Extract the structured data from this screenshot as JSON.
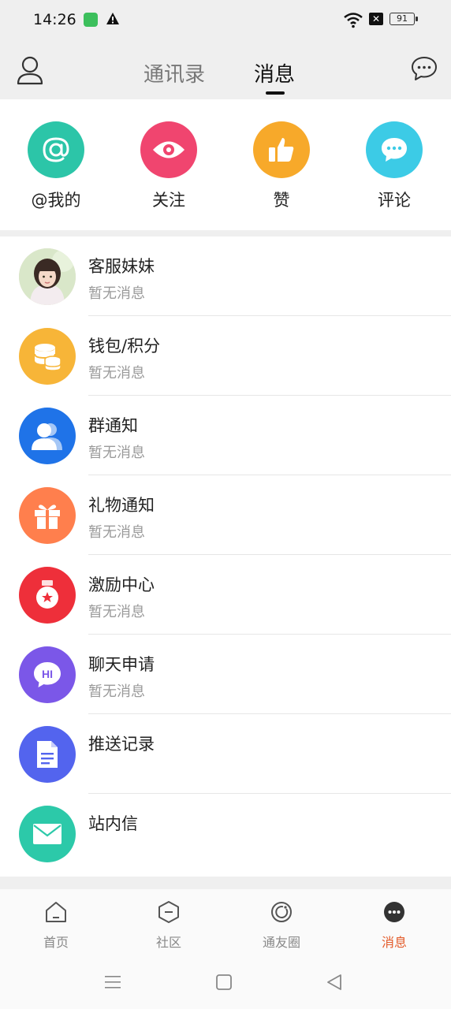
{
  "status_bar": {
    "time": "14:26",
    "battery": "91"
  },
  "header": {
    "tabs": [
      {
        "label": "通讯录",
        "active": false
      },
      {
        "label": "消息",
        "active": true
      }
    ]
  },
  "quick_actions": [
    {
      "label": "@我的",
      "icon": "at-icon",
      "color": "#2cc5a8"
    },
    {
      "label": "关注",
      "icon": "eye-icon",
      "color": "#f0456f"
    },
    {
      "label": "赞",
      "icon": "thumbs-up-icon",
      "color": "#f7a92a"
    },
    {
      "label": "评论",
      "icon": "comment-icon",
      "color": "#3ccbe6"
    }
  ],
  "messages": [
    {
      "title": "客服妹妹",
      "subtitle": "暂无消息",
      "icon": "customer-service-avatar"
    },
    {
      "title": "钱包/积分",
      "subtitle": "暂无消息",
      "icon": "coins-icon",
      "color": "#f7b538"
    },
    {
      "title": "群通知",
      "subtitle": "暂无消息",
      "icon": "group-icon",
      "color": "#1f73e8"
    },
    {
      "title": "礼物通知",
      "subtitle": "暂无消息",
      "icon": "gift-icon",
      "color": "#ff7f4d"
    },
    {
      "title": "激励中心",
      "subtitle": "暂无消息",
      "icon": "medal-icon",
      "color": "#ee2f3a"
    },
    {
      "title": "聊天申请",
      "subtitle": "暂无消息",
      "icon": "hi-bubble-icon",
      "color": "#7b57e8"
    },
    {
      "title": "推送记录",
      "subtitle": "",
      "icon": "document-icon",
      "color": "#5364ee"
    },
    {
      "title": "站内信",
      "subtitle": "",
      "icon": "mail-icon",
      "color": "#2cc9a9"
    }
  ],
  "tabbar": [
    {
      "label": "首页",
      "icon": "home-icon",
      "active": false
    },
    {
      "label": "社区",
      "icon": "community-icon",
      "active": false
    },
    {
      "label": "通友圈",
      "icon": "moments-icon",
      "active": false
    },
    {
      "label": "消息",
      "icon": "message-icon",
      "active": true
    }
  ],
  "colors": {
    "accent": "#e35b2a"
  }
}
